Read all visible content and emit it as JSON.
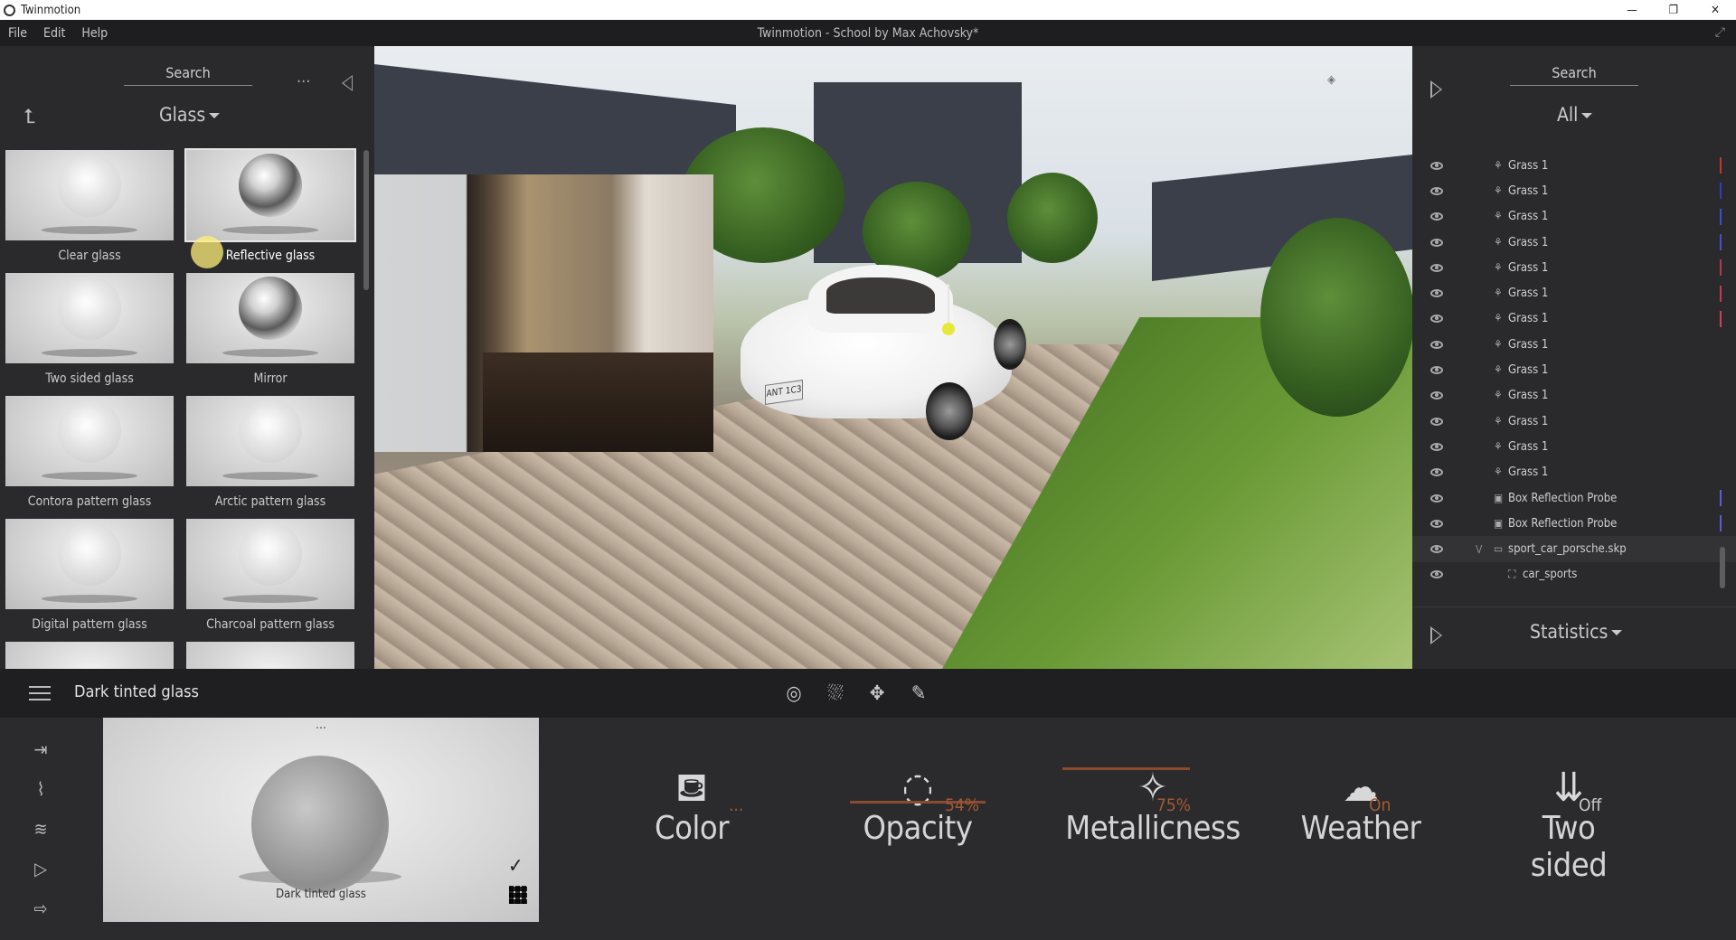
{
  "window": {
    "app_title": "Twinmotion",
    "doc_title": "Twinmotion - School by Max Achovsky*",
    "controls": [
      "—",
      "❐",
      "✕"
    ]
  },
  "menu": [
    "File",
    "Edit",
    "Help"
  ],
  "library": {
    "search_label": "Search",
    "more_label": "...",
    "category": "Glass",
    "items": [
      {
        "label": "Clear glass",
        "style": "glass"
      },
      {
        "label": "Reflective glass",
        "style": "chrome",
        "selected": true
      },
      {
        "label": "Two sided glass",
        "style": "glass"
      },
      {
        "label": "Mirror",
        "style": "chrome"
      },
      {
        "label": "Contora pattern glass",
        "style": "glass"
      },
      {
        "label": "Arctic pattern glass",
        "style": "glass"
      },
      {
        "label": "Digital pattern glass",
        "style": "glass"
      },
      {
        "label": "Charcoal pattern glass",
        "style": "glass"
      }
    ]
  },
  "viewport": {
    "plate_text": "ANT 1C3"
  },
  "scene": {
    "search_label": "Search",
    "filter": "All",
    "items": [
      {
        "name": "Grass 1",
        "type": "foliage",
        "tag": "#c0392b"
      },
      {
        "name": "Grass 1",
        "type": "foliage",
        "tag": "#2d3fbf"
      },
      {
        "name": "Grass 1",
        "type": "foliage",
        "tag": "#3b4fd1"
      },
      {
        "name": "Grass 1",
        "type": "foliage",
        "tag": "#4750c8"
      },
      {
        "name": "Grass 1",
        "type": "foliage",
        "tag": "#b03a4a"
      },
      {
        "name": "Grass 1",
        "type": "foliage",
        "tag": "#c43a56"
      },
      {
        "name": "Grass 1",
        "type": "foliage",
        "tag": "#d04058"
      },
      {
        "name": "Grass 1",
        "type": "foliage",
        "tag": ""
      },
      {
        "name": "Grass 1",
        "type": "foliage",
        "tag": ""
      },
      {
        "name": "Grass 1",
        "type": "foliage",
        "tag": ""
      },
      {
        "name": "Grass 1",
        "type": "foliage",
        "tag": ""
      },
      {
        "name": "Grass 1",
        "type": "foliage",
        "tag": ""
      },
      {
        "name": "Grass 1",
        "type": "foliage",
        "tag": ""
      },
      {
        "name": "Box Reflection Probe",
        "type": "probe",
        "tag": "#5a5ed6"
      },
      {
        "name": "Box Reflection Probe",
        "type": "probe",
        "tag": "#5a5ed6"
      },
      {
        "name": "sport_car_porsche.skp",
        "type": "folder",
        "tag": "",
        "expanded": true,
        "active": true
      },
      {
        "name": "car_sports",
        "type": "group",
        "tag": "",
        "indent": true
      }
    ],
    "statistics_label": "Statistics"
  },
  "editor": {
    "material_name": "Dark tinted glass",
    "preview_caption": "Dark tinted glass",
    "preview_dots": "...",
    "params": [
      {
        "key": "color",
        "label": "Color",
        "value": "...",
        "icon": "paint-bucket-icon"
      },
      {
        "key": "opacity",
        "label": "Opacity",
        "value": "54%",
        "icon": "opacity-icon"
      },
      {
        "key": "metallicness",
        "label": "Metallicness",
        "value": "75%",
        "icon": "metallic-icon"
      },
      {
        "key": "weather",
        "label": "Weather",
        "value": "On",
        "icon": "weather-icon"
      },
      {
        "key": "two_sided",
        "label": "Two sided",
        "value": "Off",
        "icon": "two-sided-icon"
      }
    ]
  },
  "colors": {
    "accent": "#a35a35",
    "panel": "#2a2a2c",
    "background": "#2b2b2d"
  }
}
